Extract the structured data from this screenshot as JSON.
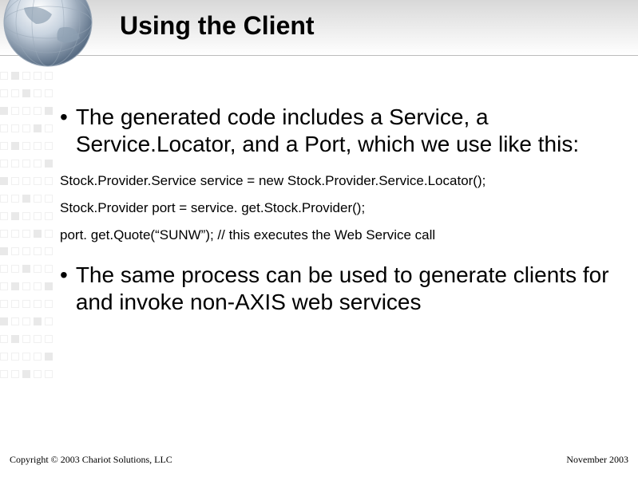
{
  "title": "Using the Client",
  "bullets": {
    "b1": "The generated code includes a Service, a Service.Locator, and a Port, which we use like this:",
    "b2": "The same process can be used to generate clients for and invoke non-AXIS web services"
  },
  "code": {
    "l1": "Stock.Provider.Service service = new Stock.Provider.Service.Locator();",
    "l2": "Stock.Provider port = service. get.Stock.Provider();",
    "l3": "port. get.Quote(“SUNW”); // this executes the Web Service call"
  },
  "footer": {
    "left": "Copyright © 2003 Chariot Solutions, LLC",
    "right": "November 2003"
  }
}
